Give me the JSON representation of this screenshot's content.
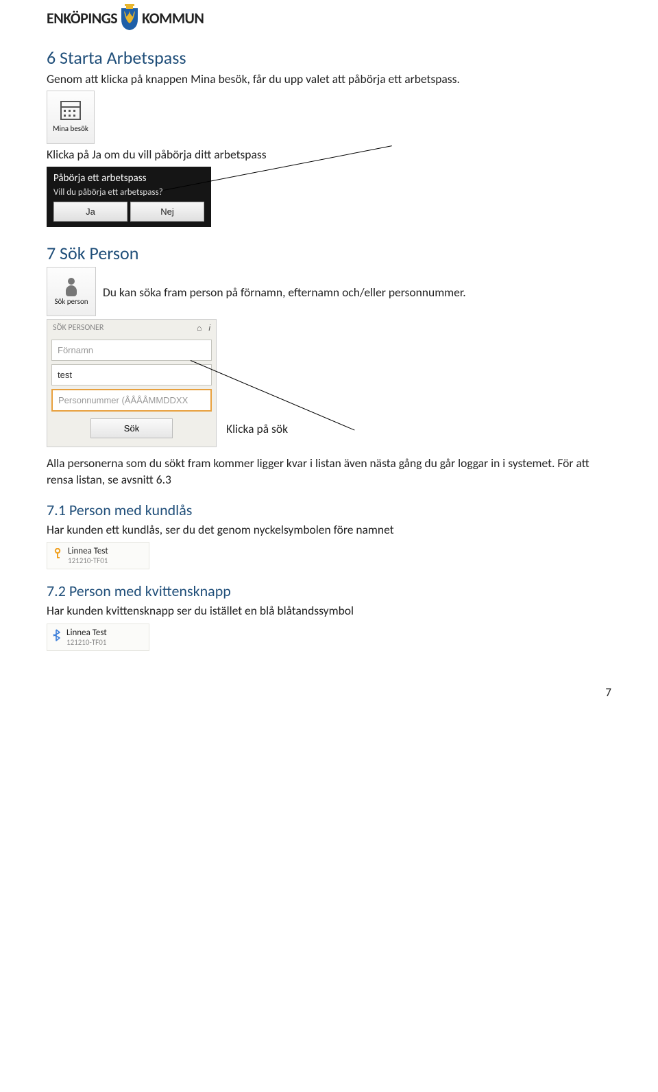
{
  "header": {
    "left": "ENKÖPINGS",
    "right": "KOMMUN"
  },
  "sec6": {
    "title": "6   Starta Arbetspass",
    "intro": "Genom att klicka på knappen Mina besök, får du upp valet att påbörja ett arbetspass.",
    "mina_besok_label": "Mina besök",
    "instr2": "Klicka på Ja om du vill påbörja ditt arbetspass",
    "dialog": {
      "title": "Påbörja ett arbetspass",
      "msg": "Vill du påbörja ett arbetspass?",
      "ja": "Ja",
      "nej": "Nej"
    }
  },
  "sec7": {
    "title": "7   Sök Person",
    "sok_person_label": "Sök person",
    "desc": "Du kan söka fram person på förnamn, efternamn och/eller personnummer.",
    "panel": {
      "head": "SÖK PERSONER",
      "fornamn_ph": "Förnamn",
      "efternamn_val": "test",
      "pnr_ph": "Personnummer (ÅÅÅÅMMDDXX",
      "sok_btn": "Sök"
    },
    "klicka_label": "Klicka på sök",
    "after": "Alla personerna som du sökt fram kommer ligger kvar i listan även nästa gång du går loggar in i systemet. För att rensa listan, se avsnitt 6.3"
  },
  "sec71": {
    "title": "7.1   Person med kundlås",
    "body": "Har kunden ett kundlås, ser du det genom nyckelsymbolen före namnet",
    "person": {
      "name": "Linnea Test",
      "id": "121210-TF01"
    }
  },
  "sec72": {
    "title": "7.2   Person med kvittensknapp",
    "body": "Har kunden kvittensknapp ser du istället en blå blåtandssymbol",
    "person": {
      "name": "Linnea Test",
      "id": "121210-TF01"
    }
  },
  "page_number": "7"
}
